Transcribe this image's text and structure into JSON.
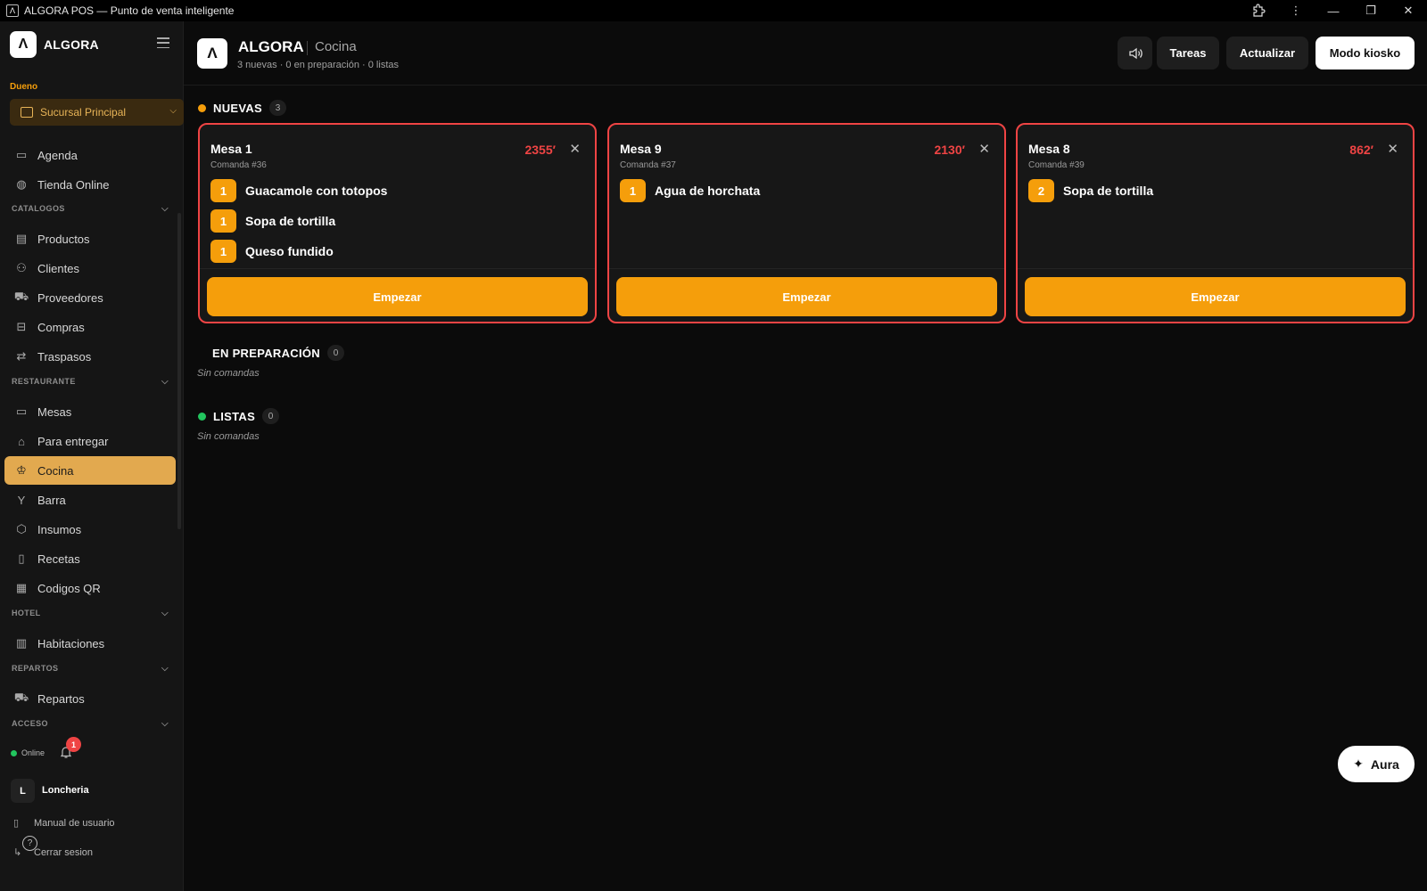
{
  "window": {
    "title": "ALGORA POS — Punto de venta inteligente",
    "icon": "algora-logo-icon"
  },
  "sidebar": {
    "brand": "ALGORA",
    "brand_logo": "Λ",
    "role": "Dueno",
    "branch": "Sucursal Principal",
    "items_top": [
      {
        "label": "Agenda",
        "icon": "calendar-icon"
      },
      {
        "label": "Tienda Online",
        "icon": "globe-icon"
      }
    ],
    "sections": {
      "catalogos": "CATALOGOS",
      "restaurante": "RESTAURANTE",
      "hotel": "HOTEL",
      "repartos": "REPARTOS",
      "acceso": "ACCESO"
    },
    "catalogos_items": [
      {
        "label": "Productos",
        "icon": "archive-icon"
      },
      {
        "label": "Clientes",
        "icon": "users-icon"
      },
      {
        "label": "Proveedores",
        "icon": "truck-icon"
      },
      {
        "label": "Compras",
        "icon": "inbox-icon"
      },
      {
        "label": "Traspasos",
        "icon": "transfer-icon"
      }
    ],
    "restaurante_items": [
      {
        "label": "Mesas",
        "icon": "table-icon"
      },
      {
        "label": "Para entregar",
        "icon": "cloche-icon"
      },
      {
        "label": "Cocina",
        "icon": "chef-hat-icon"
      },
      {
        "label": "Barra",
        "icon": "cocktail-icon"
      },
      {
        "label": "Insumos",
        "icon": "box-icon"
      },
      {
        "label": "Recetas",
        "icon": "book-icon"
      },
      {
        "label": "Codigos QR",
        "icon": "qr-icon"
      }
    ],
    "hotel_items": [
      {
        "label": "Habitaciones",
        "icon": "building-icon"
      }
    ],
    "repartos_items": [
      {
        "label": "Repartos",
        "icon": "truck-icon"
      }
    ],
    "status": "Online",
    "notifications": "1",
    "user_initial": "L",
    "user_name": "Loncheria",
    "manual": "Manual de usuario",
    "logout": "Cerrar sesion"
  },
  "header": {
    "logo": "Λ",
    "brand": "ALGORA",
    "page": "Cocina",
    "summary": "3 nuevas · 0 en preparación · 0 listas",
    "buttons": {
      "tareas": "Tareas",
      "actualizar": "Actualizar",
      "kiosko": "Modo kiosko"
    }
  },
  "columns": {
    "nuevas": {
      "label": "NUEVAS",
      "count": "3",
      "color": "#f59e0b"
    },
    "preparacion": {
      "label": "EN PREPARACIÓN",
      "count": "0",
      "empty": "Sin comandas"
    },
    "listas": {
      "label": "LISTAS",
      "count": "0",
      "color": "#22c55e",
      "empty": "Sin comandas"
    }
  },
  "orders": [
    {
      "mesa": "Mesa 1",
      "comanda": "Comanda #36",
      "time": "2355′",
      "items": [
        {
          "qty": "1",
          "name": "Guacamole con totopos"
        },
        {
          "qty": "1",
          "name": "Sopa de tortilla"
        },
        {
          "qty": "1",
          "name": "Queso fundido"
        }
      ],
      "action": "Empezar"
    },
    {
      "mesa": "Mesa 9",
      "comanda": "Comanda #37",
      "time": "2130′",
      "items": [
        {
          "qty": "1",
          "name": "Agua de horchata"
        }
      ],
      "action": "Empezar"
    },
    {
      "mesa": "Mesa 8",
      "comanda": "Comanda #39",
      "time": "862′",
      "items": [
        {
          "qty": "2",
          "name": "Sopa de tortilla"
        }
      ],
      "action": "Empezar"
    }
  ],
  "aura": "Aura",
  "colors": {
    "accent": "#f59e0b",
    "late": "#ef4444",
    "active_nav": "#e2a94f"
  }
}
